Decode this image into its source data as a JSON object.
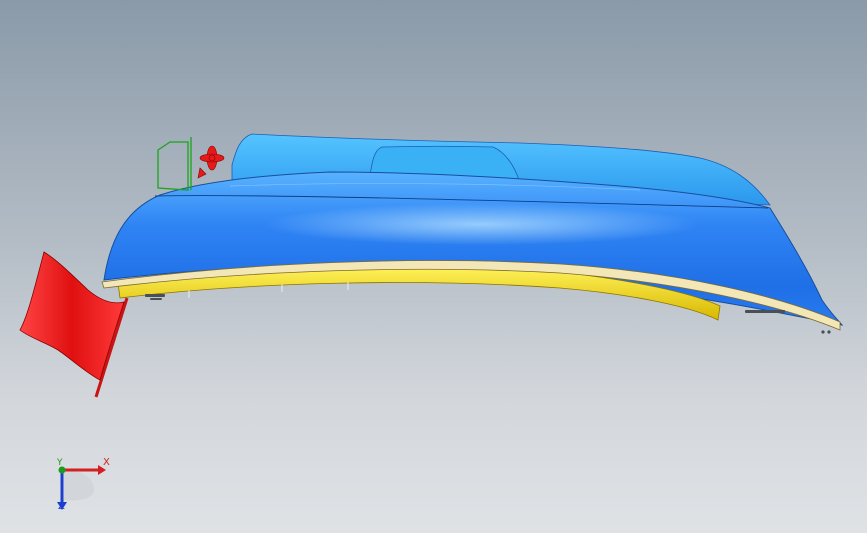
{
  "viewport": {
    "background_top": "#8a9aa9",
    "background_bottom": "#dfe2e5"
  },
  "model": {
    "body_color": "#2f7ff0",
    "deck_color": "#3aa8f0",
    "base_rail_color": "#f0d800",
    "trim_color": "#f2e7b6",
    "flag_color": "#ee1a1a",
    "sketch_color": "#1aa51a",
    "propeller_color": "#e61a1a"
  },
  "triad": {
    "x_label": "X",
    "y_label": "Y",
    "z_label": "Z",
    "x_color": "#d42020",
    "y_color": "#1a9c1a",
    "z_color": "#1c3fd0"
  }
}
